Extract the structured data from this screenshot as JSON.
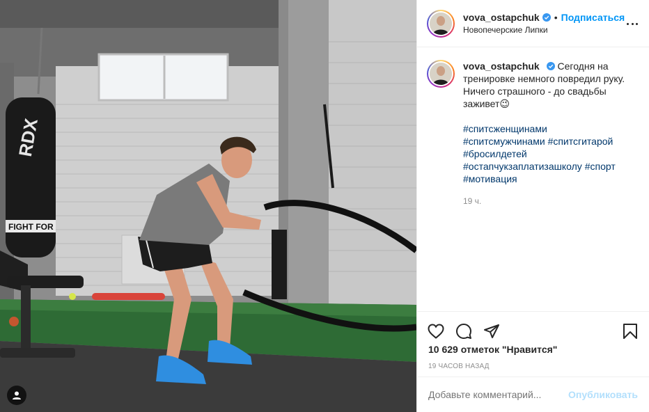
{
  "post": {
    "username": "vova_ostapchuk",
    "follow_label": "Подписаться",
    "separator": "•",
    "location": "Новопечерские Липки",
    "caption_text": "Сегодня на тренировке немного повредил руку. Ничего страшного - до свадьбы заживет😉",
    "hashtags": [
      "#спитсженщинами",
      "#спитсмужчинами",
      "#спитсгитарой",
      "#бросилдетей",
      "#остапчукзаплатизашколу",
      "#спорт",
      "#мотивация"
    ],
    "caption_time": "19 ч.",
    "likes_text": "10 629 отметок \"Нравится\"",
    "time_ago": "19 ЧАСОВ НАЗАД",
    "comment_placeholder": "Добавьте комментарий...",
    "publish_label": "Опубликовать"
  },
  "icons": {
    "verified": "verified-badge-icon",
    "like": "heart-icon",
    "comment": "comment-bubble-icon",
    "share": "paper-plane-icon",
    "save": "bookmark-icon",
    "more": "more-options-icon",
    "tagged": "user-tag-icon"
  },
  "colors": {
    "link": "#0095f6",
    "hashtag": "#00376b",
    "muted": "#8e8e8e",
    "publish_disabled": "#b2dffc",
    "verified": "#3897f0"
  }
}
